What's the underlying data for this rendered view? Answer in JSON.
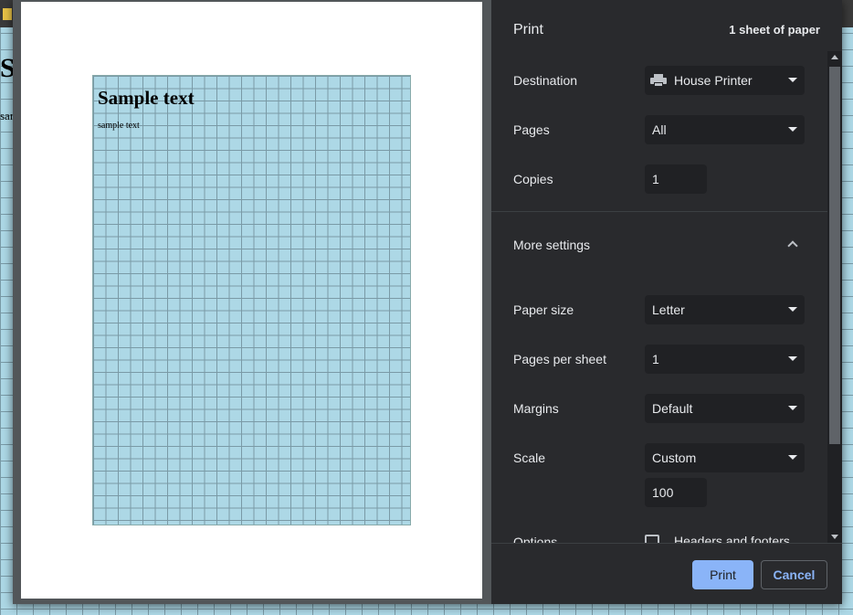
{
  "background_page": {
    "heading": "S",
    "subtext": "sar"
  },
  "preview": {
    "title": "Sample text",
    "body": "sample text"
  },
  "header": {
    "title": "Print",
    "sheets": "1 sheet of paper"
  },
  "settings": {
    "destination": {
      "label": "Destination",
      "value": "House Printer",
      "icon": "printer-icon"
    },
    "pages": {
      "label": "Pages",
      "value": "All"
    },
    "copies": {
      "label": "Copies",
      "value": "1"
    },
    "more_settings": {
      "label": "More settings",
      "icon": "chevron-up-icon"
    },
    "paper_size": {
      "label": "Paper size",
      "value": "Letter"
    },
    "pages_per_sheet": {
      "label": "Pages per sheet",
      "value": "1"
    },
    "margins": {
      "label": "Margins",
      "value": "Default"
    },
    "scale": {
      "label": "Scale",
      "value": "Custom",
      "custom_value": "100"
    },
    "options": {
      "label": "Options",
      "headers_footers": "Headers and footers"
    }
  },
  "footer": {
    "print_label": "Print",
    "cancel_label": "Cancel"
  },
  "colors": {
    "accent": "#8ab4f8",
    "panel": "#292a2d",
    "field": "#202124",
    "grid_bg": "#add8e6"
  }
}
